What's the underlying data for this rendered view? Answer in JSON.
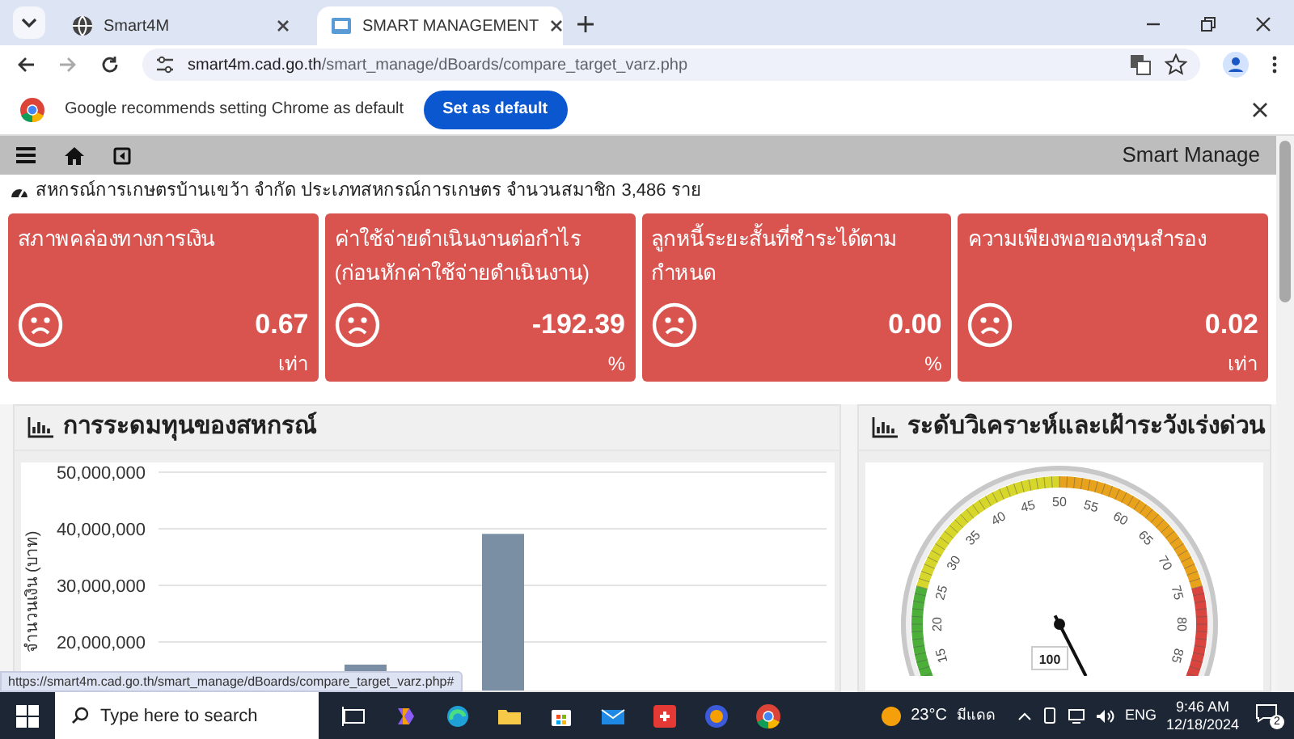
{
  "browser": {
    "tabs": [
      {
        "title": "Smart4M",
        "selected": false
      },
      {
        "title": "SMART MANAGEMENT",
        "selected": true
      }
    ],
    "url_domain": "smart4m.cad.go.th",
    "url_path": "/smart_manage/dBoards/compare_target_varz.php",
    "infobar": {
      "message": "Google recommends setting Chrome as default",
      "button": "Set as default"
    },
    "status_url": "https://smart4m.cad.go.th/smart_manage/dBoards/compare_target_varz.php#"
  },
  "navbar": {
    "brand": "Smart Manage"
  },
  "org_info": "สหกรณ์การเกษตรบ้านเขว้า จำกัด ประเภทสหกรณ์การเกษตร จำนวนสมาชิก 3,486 ราย",
  "cards": [
    {
      "title": "สภาพคล่องทางการเงิน",
      "value": "0.67",
      "unit": "เท่า"
    },
    {
      "title": "ค่าใช้จ่ายดำเนินงานต่อกำไร (ก่อนหักค่าใช้จ่ายดำเนินงาน)",
      "value": "-192.39",
      "unit": "%"
    },
    {
      "title": "ลูกหนี้ระยะสั้นที่ชำระได้ตามกำหนด",
      "value": "0.00",
      "unit": "%"
    },
    {
      "title": "ความเพียงพอของทุนสำรอง",
      "value": "0.02",
      "unit": "เท่า"
    }
  ],
  "funding_panel": {
    "title": "การระดมทุนของสหกรณ์",
    "chart_data": {
      "type": "bar",
      "grid": true,
      "ylabel": "จำนวนเงิน (บาท)",
      "ylim": [
        0,
        50000000
      ],
      "yticks": [
        {
          "value": 20000000,
          "label": "20,000,000"
        },
        {
          "value": 30000000,
          "label": "30,000,000"
        },
        {
          "value": 40000000,
          "label": "40,000,000"
        },
        {
          "value": 50000000,
          "label": "50,000,000"
        }
      ],
      "values": [
        16000000,
        39100000
      ]
    }
  },
  "gauge_panel": {
    "title": "ระดับวิเคราะห์และเฝ้าระวังเร่งด่วน",
    "gauge": {
      "tick_labels": [
        "15",
        "20",
        "25",
        "30",
        "35",
        "40",
        "45",
        "50",
        "55",
        "60",
        "65",
        "70",
        "75",
        "80",
        "85"
      ],
      "reading": "100"
    }
  },
  "taskbar": {
    "search_placeholder": "Type here to search",
    "temperature": "23°C",
    "weather": "มีแดด",
    "language": "ENG",
    "time": "9:46 AM",
    "date": "12/18/2024",
    "notifications": "2"
  }
}
